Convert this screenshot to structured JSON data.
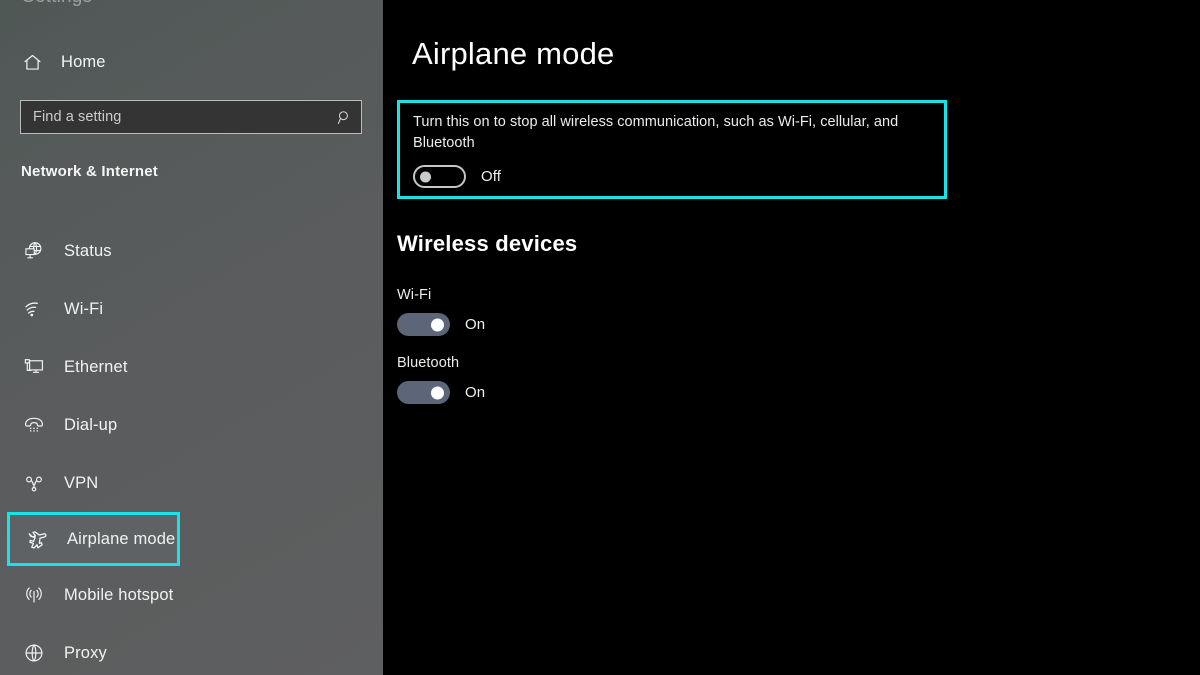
{
  "accent_color": "#18e3e8",
  "sidebar": {
    "clipped_title": "Settings",
    "home": {
      "label": "Home",
      "icon": "home-icon"
    },
    "search": {
      "placeholder": "Find a setting",
      "value": "",
      "icon": "search-icon"
    },
    "category_header": "Network & Internet",
    "items": [
      {
        "label": "Status",
        "icon": "status-globe-icon",
        "selected": false
      },
      {
        "label": "Wi-Fi",
        "icon": "wifi-icon",
        "selected": false
      },
      {
        "label": "Ethernet",
        "icon": "ethernet-icon",
        "selected": false
      },
      {
        "label": "Dial-up",
        "icon": "dialup-phone-icon",
        "selected": false
      },
      {
        "label": "VPN",
        "icon": "vpn-icon",
        "selected": false
      },
      {
        "label": "Airplane mode",
        "icon": "airplane-icon",
        "selected": true
      },
      {
        "label": "Mobile hotspot",
        "icon": "mobile-hotspot-icon",
        "selected": false
      },
      {
        "label": "Proxy",
        "icon": "proxy-globe-icon",
        "selected": false
      }
    ]
  },
  "main": {
    "title": "Airplane mode",
    "airplane": {
      "description": "Turn this on to stop all wireless communication, such as Wi-Fi, cellular, and Bluetooth",
      "toggle_state": "Off",
      "toggle_on": false
    },
    "wireless_devices": {
      "heading": "Wireless devices",
      "devices": [
        {
          "name": "Wi-Fi",
          "toggle_state": "On",
          "toggle_on": true
        },
        {
          "name": "Bluetooth",
          "toggle_state": "On",
          "toggle_on": true
        }
      ]
    }
  }
}
